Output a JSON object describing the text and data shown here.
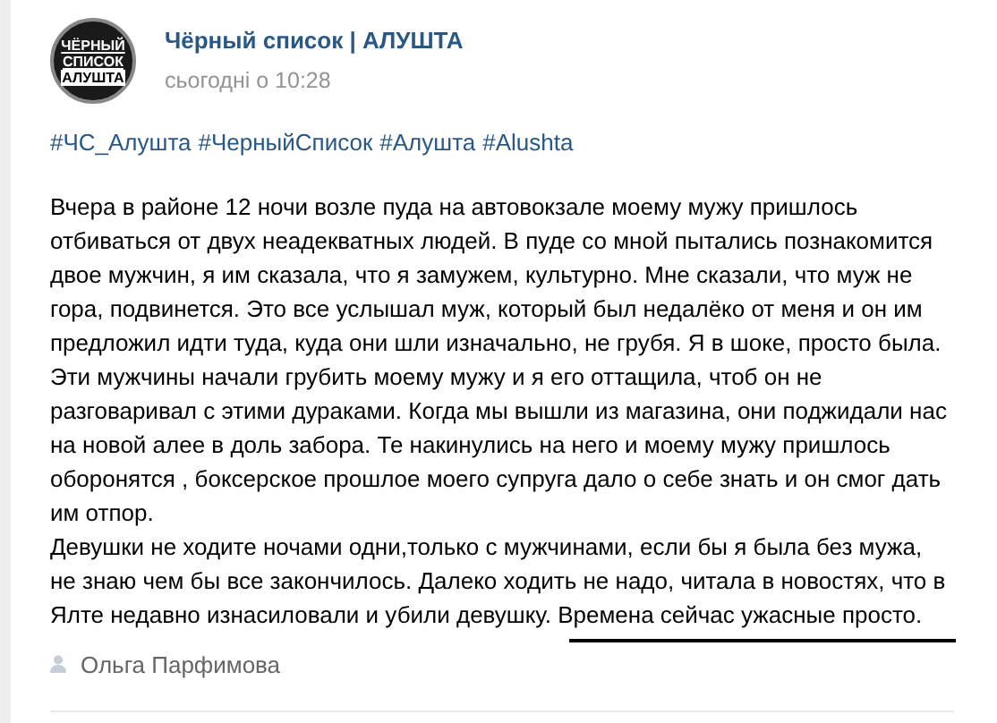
{
  "post": {
    "avatar": {
      "lines": [
        "ЧЁРНЫЙ",
        "СПИСОК",
        "АЛУШТА"
      ]
    },
    "author": "Чёрный список | АЛУШТА",
    "time": "сьогодні о 10:28",
    "hashtags": [
      "#ЧС_Алушта",
      "#ЧерныйСписок",
      "#Алушта",
      "#Alushta"
    ],
    "paragraphs": [
      "Вчера в районе 12 ночи возле пуда на автовокзале моему мужу пришлось отбиваться от двух неадекватных людей. В пуде со мной пытались познакомится двое мужчин, я им сказала, что я замужем, культурно. Мне сказали, что муж не гора, подвинется. Это все услышал муж, который был недалёко от меня и он им предложил идти туда, куда они шли изначально, не грубя. Я в шоке, просто была.",
      "Эти мужчины начали грубить моему мужу и я его оттащила, чтоб он не разговаривал с этими дураками. Когда мы вышли из магазина, они поджидали нас на новой алее в доль забора. Те накинулись на него и моему мужу пришлось оборонятся , боксерское прошлое моего супруга дало о себе знать и он смог дать им отпор.",
      "Девушки не ходите ночами одни,только с мужчинами, если бы я была без мужа, не знаю чем бы все закончилось. Далеко ходить не надо, читала в новостях, что в Ялте недавно изнасиловали и убили девушку. Времена сейчас ужасные просто."
    ],
    "signer": "Ольга Парфимова"
  }
}
